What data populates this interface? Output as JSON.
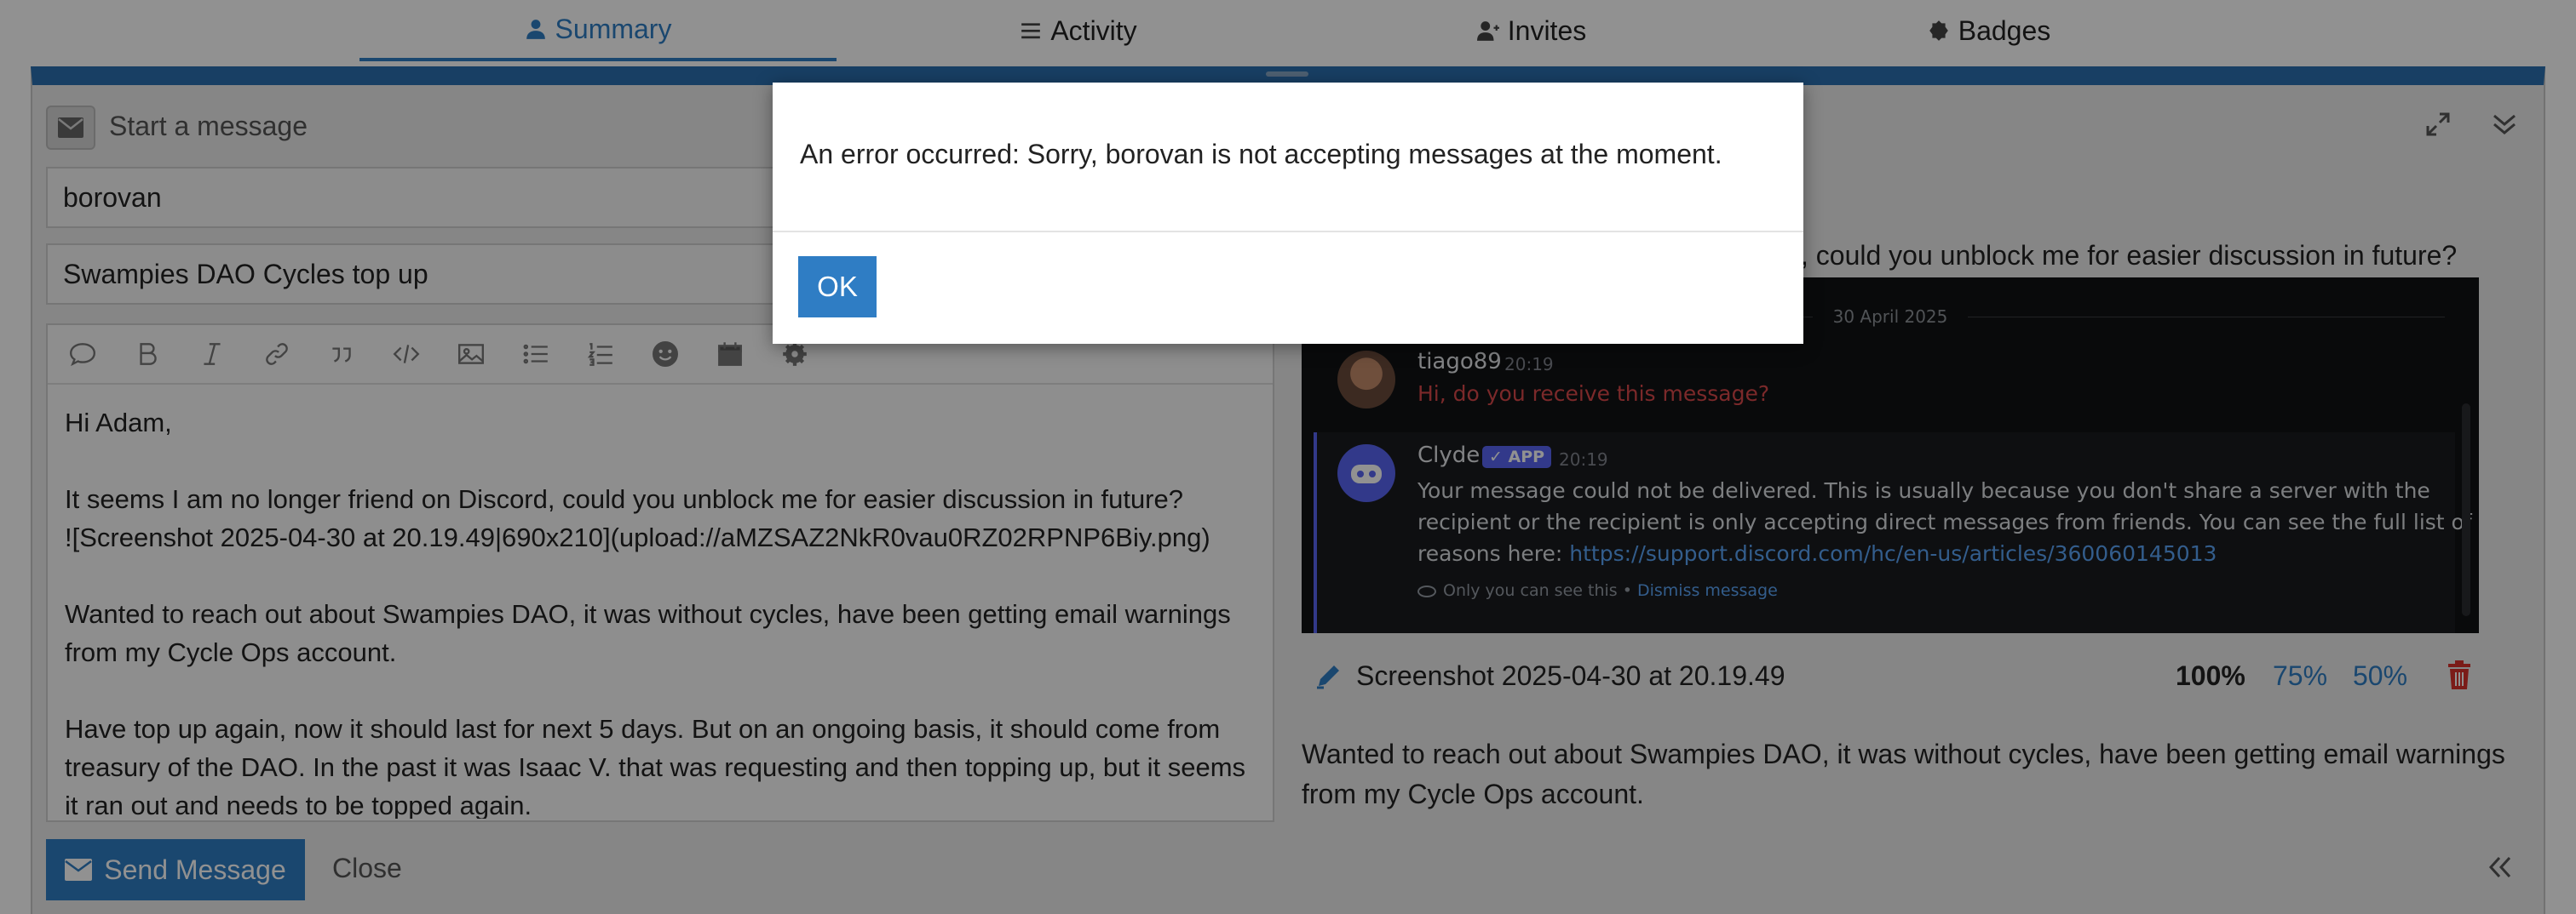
{
  "tabs": [
    {
      "label": "Summary",
      "icon": "user-icon",
      "active": true
    },
    {
      "label": "Activity",
      "icon": "list-icon",
      "active": false
    },
    {
      "label": "Invites",
      "icon": "user-plus-icon",
      "active": false
    },
    {
      "label": "Badges",
      "icon": "badge-icon",
      "active": false
    }
  ],
  "composer": {
    "title": "Start a message",
    "recipient": "borovan",
    "subject": "Swampies DAO Cycles top up",
    "body": "Hi Adam,\n\nIt seems I am no longer friend on Discord, could you unblock me for easier discussion in future?\n![Screenshot 2025-04-30 at 20.19.49|690x210](upload://aMZSAZ2NkR0vau0RZ02RPNP6Biy.png)\n\nWanted to reach out about Swampies DAO, it was without cycles, have been getting email warnings from my Cycle Ops account.\n\nHave top up again, now it should last for next 5 days. But on an ongoing basis, it should come from treasury of the DAO. In the past it was Isaac V. that was requesting and then topping up, but it seems it ran out and needs to be topped again.",
    "send_label": "Send Message",
    "close_label": "Close"
  },
  "preview": {
    "line1": ", could you unblock me for easier discussion in future?",
    "image_name": "Screenshot 2025-04-30 at 20.19.49",
    "zoom_options": [
      "100%",
      "75%",
      "50%"
    ],
    "para1_line1": "Wanted to reach out about Swampies DAO, it was without cycles, have been getting email warnings",
    "para1_line2": "from my Cycle Ops account."
  },
  "discord": {
    "date": "30 April 2025",
    "msg1_user": "tiago89",
    "msg1_time": "20:19",
    "msg1_text": "Hi, do you receive this message?",
    "msg2_user": "Clyde",
    "msg2_badge": "✓ APP",
    "msg2_time": "20:19",
    "msg2_line1": "Your message could not be delivered. This is usually because you don't share a server with the",
    "msg2_line2": "recipient or the recipient is only accepting direct messages from friends. You can see the full list of",
    "msg2_line3_prefix": "reasons here: ",
    "msg2_link": "https://support.discord.com/hc/en-us/articles/360060145013",
    "msg2_footer": "Only you can see this • ",
    "msg2_dismiss": "Dismiss message"
  },
  "modal": {
    "message": "An error occurred: Sorry, borovan is not accepting messages at the moment.",
    "ok_label": "OK"
  },
  "colors": {
    "accent": "#2f7dc4",
    "danger": "#d9302b",
    "discord_bg": "#111214",
    "discord_link": "#5aa4f6",
    "discord_red": "#d8494a"
  }
}
